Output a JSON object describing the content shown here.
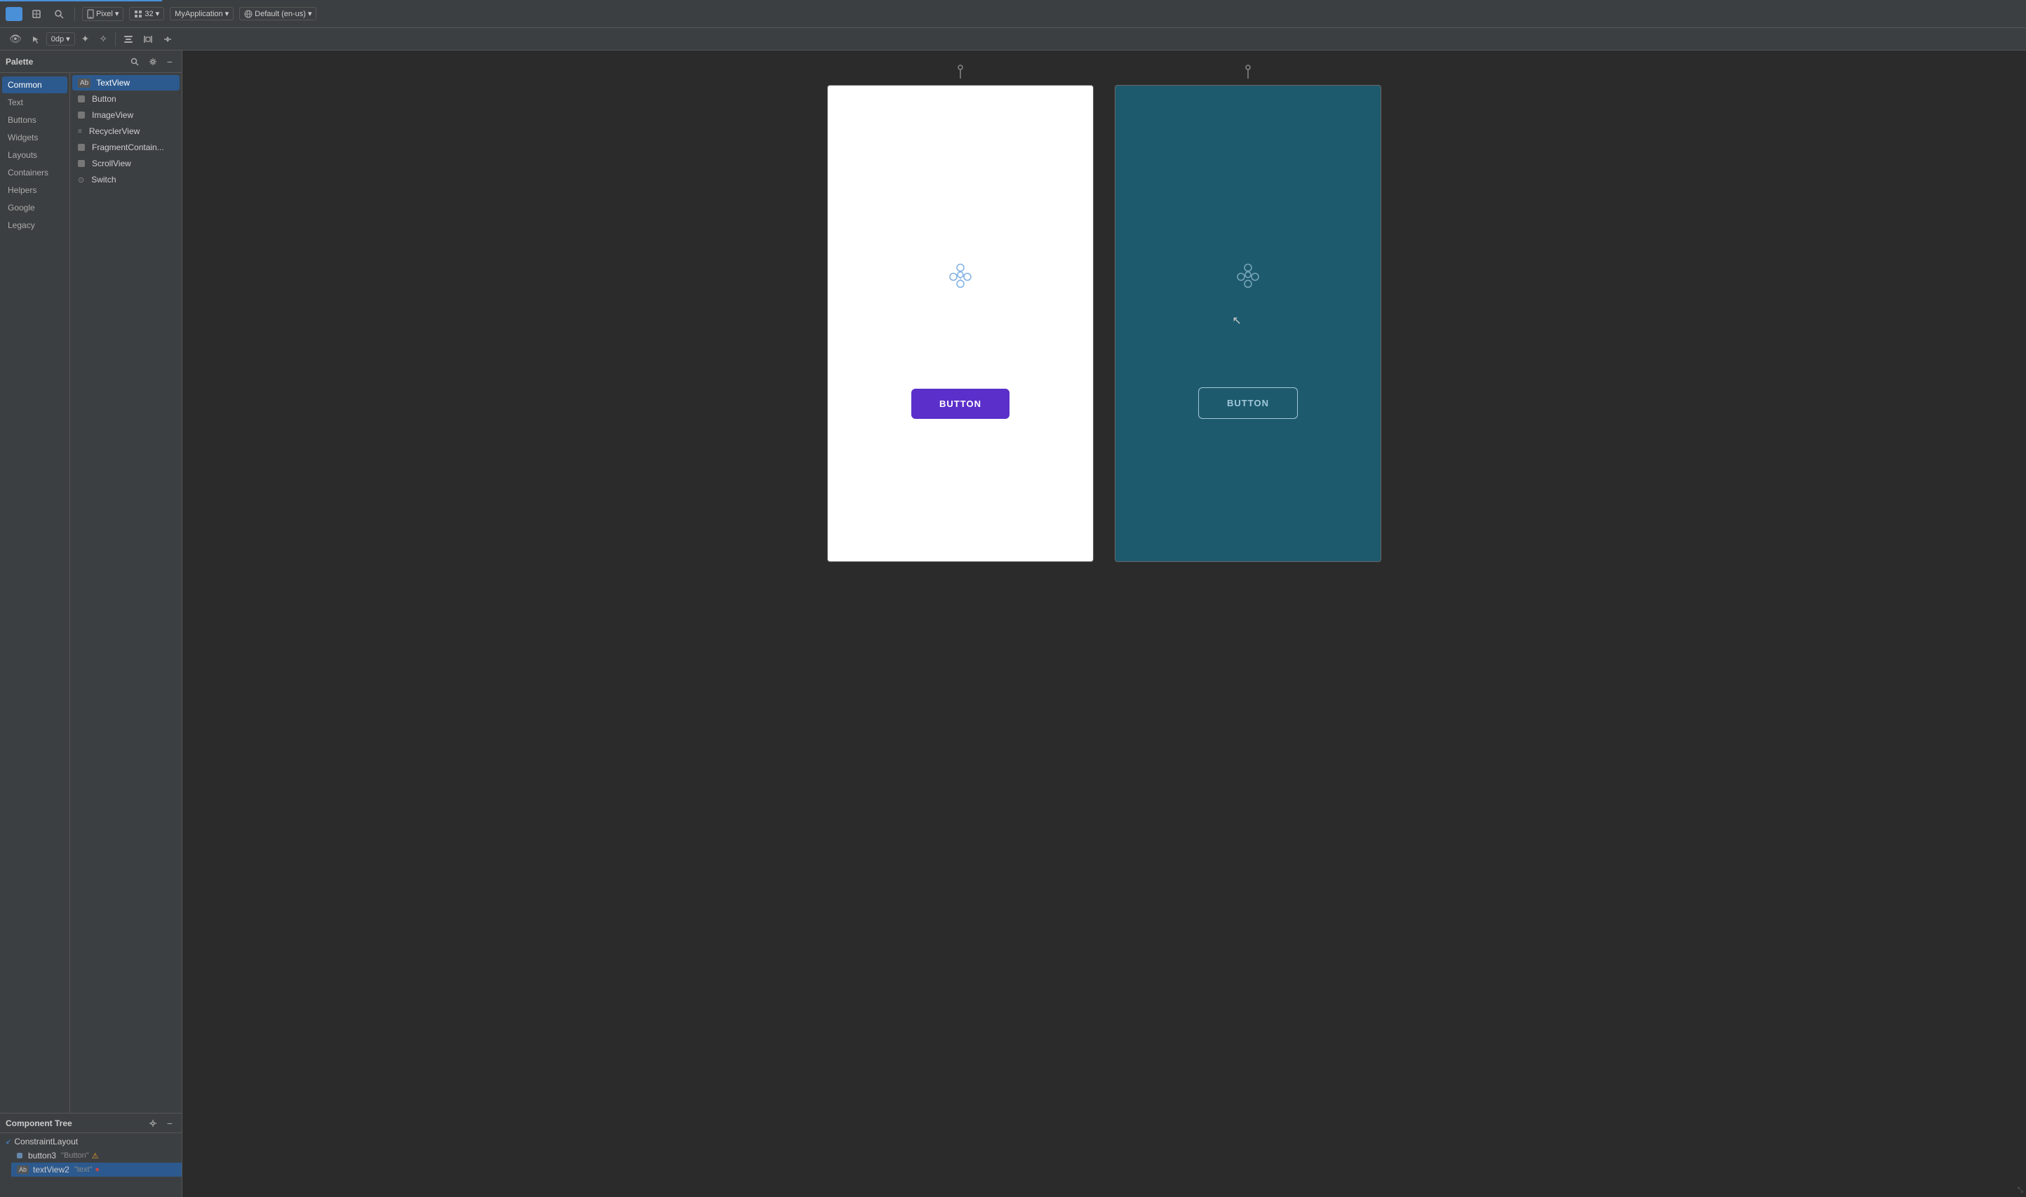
{
  "top_toolbar": {
    "progress_bar": true,
    "design_mode_icon": "◉",
    "select_icon": "↖",
    "zoom_icon": "⊕",
    "device_icon": "📱",
    "device_label": "Pixel",
    "zoom_label": "32",
    "app_label": "MyApplication",
    "locale_label": "Default (en-us)",
    "toolbar_icons": [
      "👁",
      "↖",
      "0dp",
      "⟳",
      "✦",
      "⊞",
      "≡",
      "↕"
    ]
  },
  "palette": {
    "title": "Palette",
    "search_icon": "🔍",
    "settings_icon": "⚙",
    "minimize_icon": "−",
    "categories": [
      {
        "id": "common",
        "label": "Common",
        "active": true
      },
      {
        "id": "text",
        "label": "Text"
      },
      {
        "id": "buttons",
        "label": "Buttons"
      },
      {
        "id": "widgets",
        "label": "Widgets"
      },
      {
        "id": "layouts",
        "label": "Layouts"
      },
      {
        "id": "containers",
        "label": "Containers"
      },
      {
        "id": "helpers",
        "label": "Helpers"
      },
      {
        "id": "google",
        "label": "Google"
      },
      {
        "id": "legacy",
        "label": "Legacy"
      }
    ],
    "items": [
      {
        "id": "textview",
        "label": "TextView",
        "icon": "Ab",
        "type": "text",
        "selected": true
      },
      {
        "id": "button",
        "label": "Button",
        "icon": "▭",
        "type": "rect"
      },
      {
        "id": "imageview",
        "label": "ImageView",
        "icon": "▭",
        "type": "rect"
      },
      {
        "id": "recyclerview",
        "label": "RecyclerView",
        "icon": "≡",
        "type": "list"
      },
      {
        "id": "fragmentcontain",
        "label": "FragmentContain...",
        "icon": "▭",
        "type": "rect"
      },
      {
        "id": "scrollview",
        "label": "ScrollView",
        "icon": "▭",
        "type": "rect"
      },
      {
        "id": "switch",
        "label": "Switch",
        "icon": "⊙",
        "type": "switch"
      }
    ]
  },
  "component_tree": {
    "title": "Component Tree",
    "settings_icon": "⚙",
    "minimize_icon": "−",
    "items": [
      {
        "id": "constraintlayout",
        "label": "ConstraintLayout",
        "indent": 0,
        "icon": "🔗",
        "type": "root"
      },
      {
        "id": "button3",
        "label": "button3",
        "value": "\"Button\"",
        "indent": 1,
        "icon": "▭",
        "warning": true
      },
      {
        "id": "textview2",
        "label": "textView2",
        "value": "\"text\"",
        "indent": 1,
        "icon": "Ab",
        "error": true,
        "selected": true
      }
    ]
  },
  "canvas": {
    "light_frame": {
      "button_label": "BUTTON",
      "button_bg": "#5b2fc9",
      "button_color": "#ffffff"
    },
    "dark_frame": {
      "button_label": "BUTTON",
      "button_bg": "transparent",
      "button_border": "#a0c8d8",
      "button_color": "#a0c8d8",
      "bg_color": "#1e5a6e"
    }
  },
  "second_toolbar": {
    "eye_icon": "👁",
    "pointer_icon": "↖",
    "padding_label": "0dp",
    "magic_icon": "✦",
    "star_icon": "✧",
    "align_icon": "⊞",
    "menu_icon": "≡",
    "baseline_icon": "↕"
  }
}
